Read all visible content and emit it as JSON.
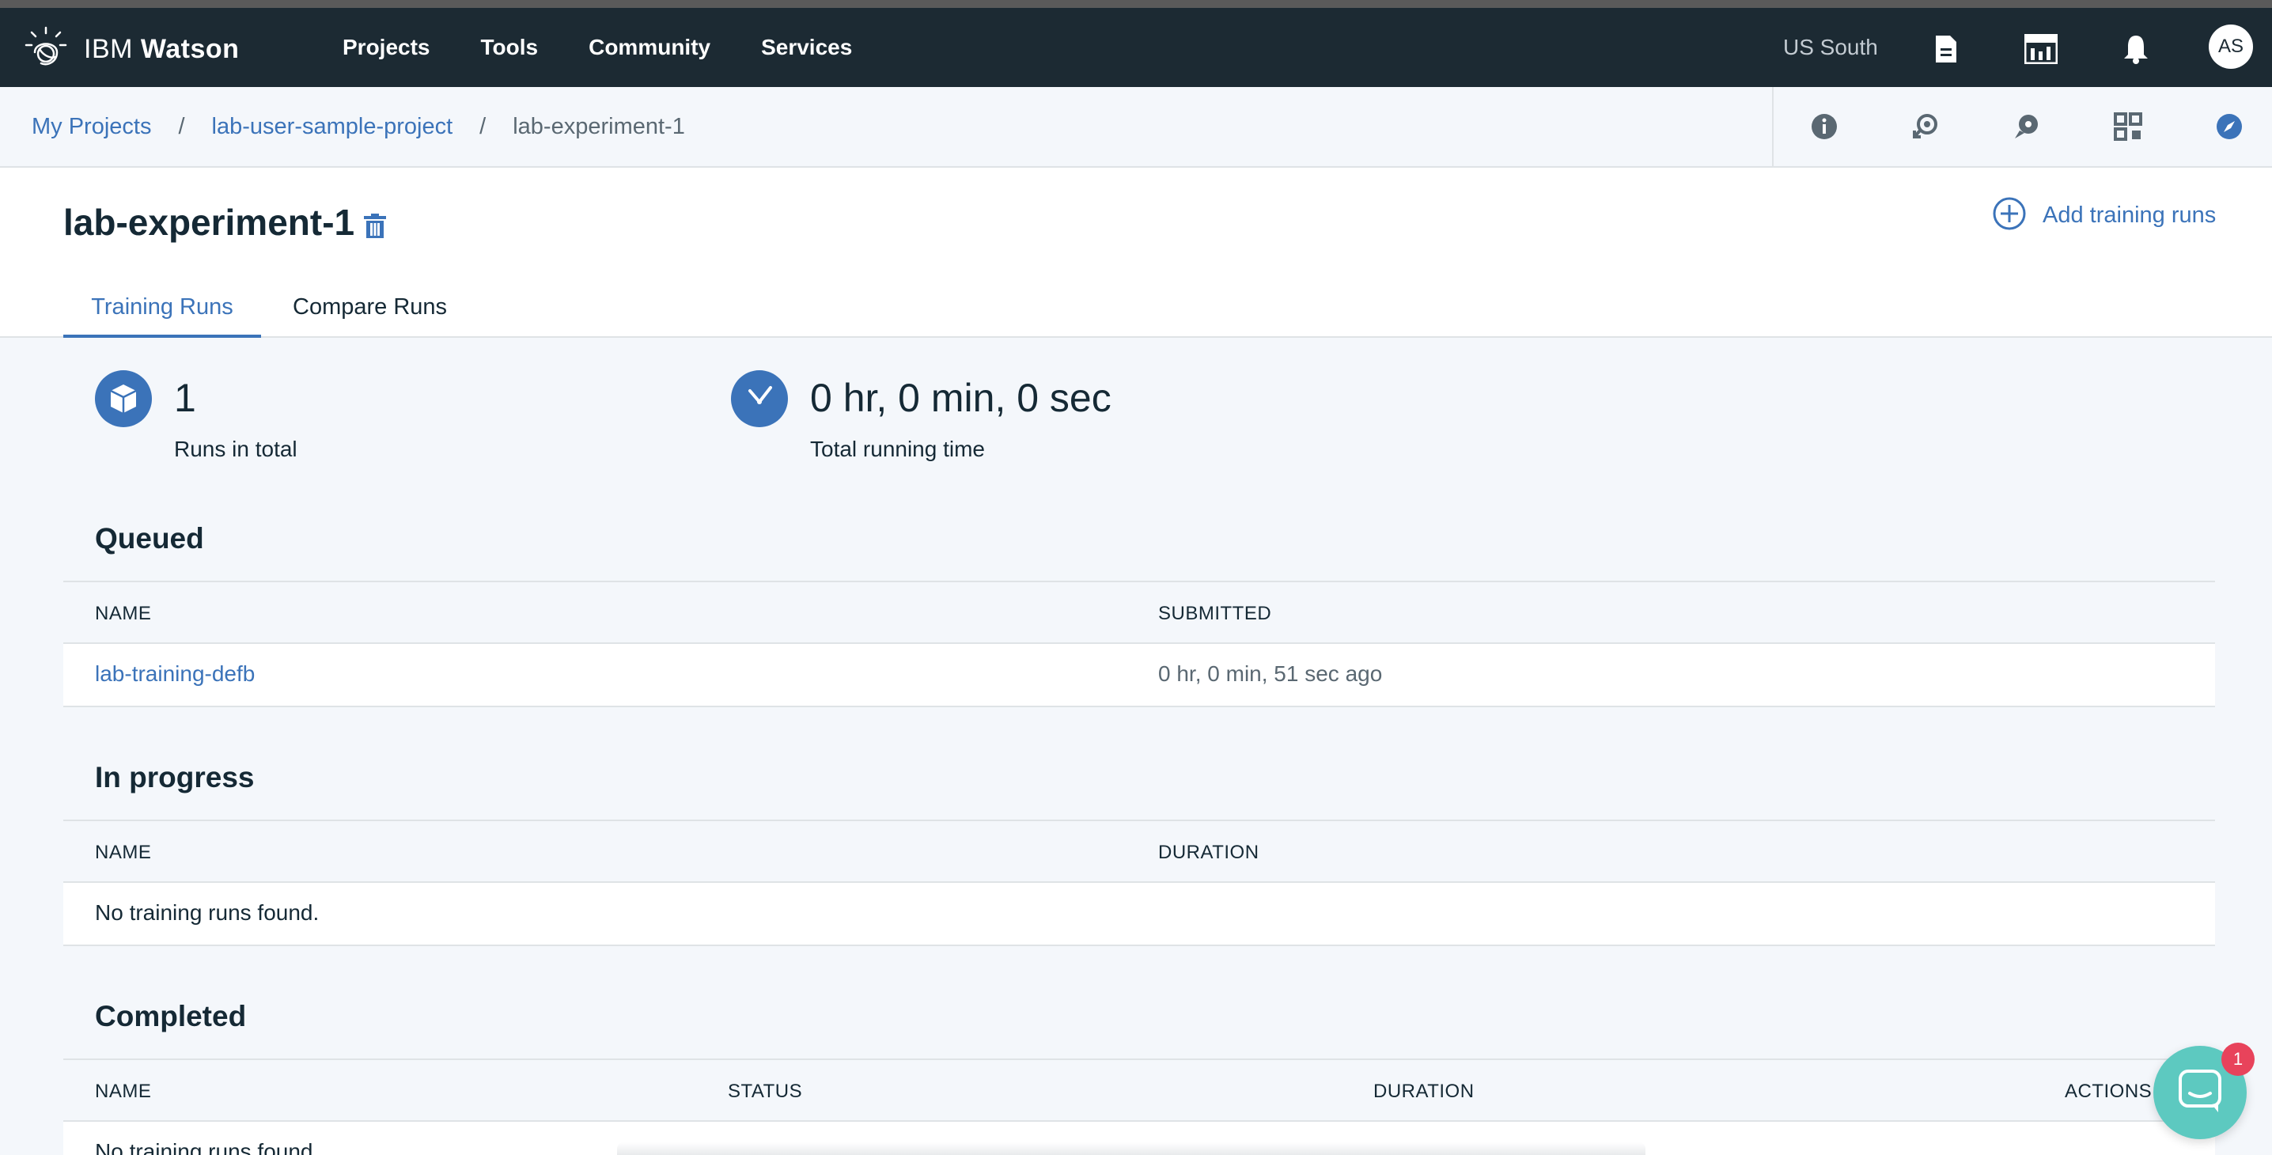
{
  "topnav": {
    "brand_ibm": "IBM",
    "brand_watson": "Watson",
    "links": [
      "Projects",
      "Tools",
      "Community",
      "Services"
    ],
    "region": "US South",
    "avatar_initials": "AS"
  },
  "breadcrumb": {
    "items": [
      "My Projects",
      "lab-user-sample-project",
      "lab-experiment-1"
    ],
    "separator": "/"
  },
  "experiment": {
    "title": "lab-experiment-1",
    "add_runs_label": "Add training runs",
    "tabs": [
      "Training Runs",
      "Compare Runs"
    ],
    "active_tab": "Training Runs"
  },
  "stats": {
    "runs_total_value": "1",
    "runs_total_label": "Runs in total",
    "running_time_value": "0 hr, 0 min, 0 sec",
    "running_time_label": "Total running time"
  },
  "queued": {
    "title": "Queued",
    "columns": [
      "NAME",
      "SUBMITTED"
    ],
    "rows": [
      {
        "name": "lab-training-defb",
        "submitted": "0 hr, 0 min, 51 sec ago"
      }
    ]
  },
  "in_progress": {
    "title": "In progress",
    "columns": [
      "NAME",
      "DURATION"
    ],
    "empty_text": "No training runs found."
  },
  "completed": {
    "title": "Completed",
    "columns": [
      "NAME",
      "STATUS",
      "DURATION",
      "ACTIONS"
    ],
    "empty_text": "No training runs found."
  },
  "chat": {
    "badge_count": "1"
  },
  "colors": {
    "nav_bg": "#1c2a33",
    "accent": "#3b73b9",
    "page_bg": "#f4f7fb",
    "chat": "#5dc9c0",
    "badge": "#e8435b"
  }
}
